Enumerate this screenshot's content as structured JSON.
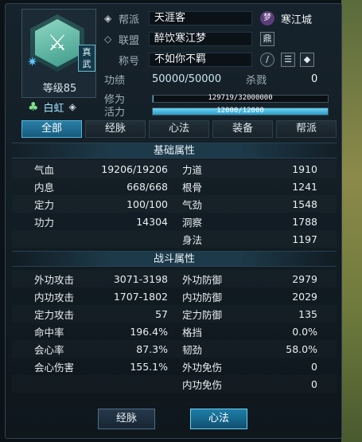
{
  "profile": {
    "school_badge": "真武",
    "level_text": "等级85",
    "camp_name": "白虹",
    "portrait_icon": "character-portrait",
    "level_icon": "gear-icon"
  },
  "info": {
    "guild_label": "帮派",
    "guild_value": "天涯客",
    "guild_tag_icon": "梦",
    "guild_city": "寒江城",
    "alliance_label": "联盟",
    "alliance_value": "醉饮寒江梦",
    "alliance_badge": "鼎",
    "title_label": "称号",
    "title_value": "不如你不羁",
    "merit_label": "功绩",
    "merit_value": "50000/50000",
    "kill_label": "杀戮",
    "kill_value": "0",
    "cultivation_label": "修为",
    "cultivation_text": "129719/32000000",
    "cultivation_fraction": 0.004,
    "vitality_label": "活力",
    "vitality_text": "12000/12000",
    "vitality_fraction": 1.0
  },
  "tabs": [
    {
      "label": "全部",
      "active": true
    },
    {
      "label": "经脉",
      "active": false
    },
    {
      "label": "心法",
      "active": false
    },
    {
      "label": "装备",
      "active": false
    },
    {
      "label": "帮派",
      "active": false
    }
  ],
  "basic": {
    "title": "基础属性",
    "rows": [
      {
        "ln": "气血",
        "lv": "19206/19206",
        "rn": "力道",
        "rv": "1910"
      },
      {
        "ln": "内息",
        "lv": "668/668",
        "rn": "根骨",
        "rv": "1241"
      },
      {
        "ln": "定力",
        "lv": "100/100",
        "rn": "气劲",
        "rv": "1548"
      },
      {
        "ln": "功力",
        "lv": "14304",
        "rn": "洞察",
        "rv": "1788"
      },
      {
        "ln": "",
        "lv": "",
        "rn": "身法",
        "rv": "1197"
      }
    ]
  },
  "combat": {
    "title": "战斗属性",
    "rows": [
      {
        "ln": "外功攻击",
        "lv": "3071-3198",
        "rn": "外功防御",
        "rv": "2979"
      },
      {
        "ln": "内功攻击",
        "lv": "1707-1802",
        "rn": "内功防御",
        "rv": "2029"
      },
      {
        "ln": "定力攻击",
        "lv": "57",
        "rn": "定力防御",
        "rv": "135"
      },
      {
        "ln": "命中率",
        "lv": "196.4%",
        "rn": "格挡",
        "rv": "0.0%"
      },
      {
        "ln": "会心率",
        "lv": "87.3%",
        "rn": "韧劲",
        "rv": "58.0%"
      },
      {
        "ln": "会心伤害",
        "lv": "155.1%",
        "rn": "外功免伤",
        "rv": "0"
      },
      {
        "ln": "",
        "lv": "",
        "rn": "内功免伤",
        "rv": "0"
      }
    ]
  },
  "buttons": {
    "meridian": "经脉",
    "mind": "心法"
  }
}
